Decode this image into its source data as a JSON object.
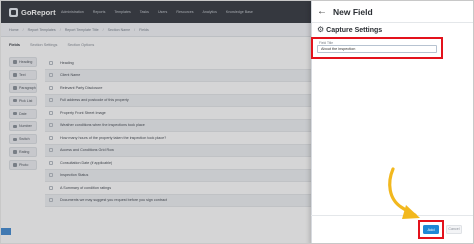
{
  "app": {
    "name": "GoReport"
  },
  "topnav": {
    "items": [
      "Administration",
      "Reports",
      "Templates",
      "Tasks",
      "Users",
      "Resources",
      "Analytics",
      "Knowledge Base"
    ]
  },
  "breadcrumb": [
    "Home",
    "/",
    "Report Templates",
    "/",
    "Report Template Title",
    "/",
    "Section Name",
    "/",
    "Fields"
  ],
  "tabs": [
    {
      "label": "Fields",
      "active": true
    },
    {
      "label": "Section Settings",
      "active": false
    },
    {
      "label": "Section Options",
      "active": false
    }
  ],
  "palette": {
    "items": [
      "Heading",
      "Text",
      "Paragraph",
      "Pick List",
      "Date",
      "Number",
      "Switch",
      "Rating",
      "Photo"
    ]
  },
  "fields": {
    "rows": [
      "Heading",
      "Client Name",
      "Relevant Party Disclosure",
      "Full address and postcode of this property",
      "Property Front Street Image",
      "Weather conditions when the inspections took place",
      "How many hours of the property taken the inspection took place?",
      "Access and Conditions Grid Row",
      "Consultation Date (if applicable)",
      "Inspection Status",
      "A Summary of condition ratings",
      "Documents we may suggest you request before you sign contract"
    ]
  },
  "panel": {
    "title": "New Field",
    "section_title": "Capture Settings",
    "field_label": "Field Title",
    "title_value": "About the inspection",
    "add_label": "Add",
    "cancel_label": "Cancel"
  },
  "colors": {
    "highlight": "#e3121c",
    "primary": "#1e88d6",
    "arrow": "#f2b81e",
    "nav_bg": "#3c4047"
  },
  "icons": {
    "back": "arrow-left-icon",
    "settings": "gear-icon"
  }
}
